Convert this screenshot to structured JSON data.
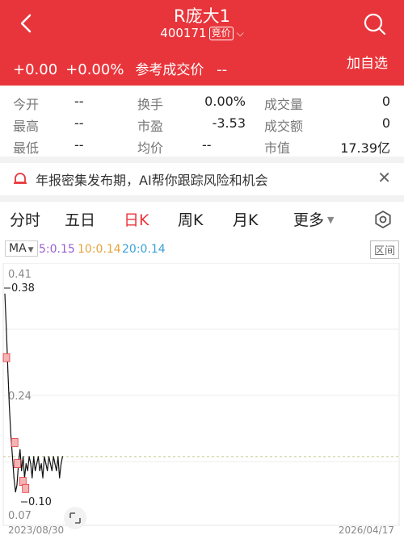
{
  "header": {
    "title": "R庞大1",
    "code": "400171",
    "badge": "竞价",
    "change": "+0.00",
    "change_pct": "+0.00%",
    "ref_label": "参考成交价",
    "ref_value": "--",
    "add_fav": "加自选",
    "bg_color": "#e8353b"
  },
  "stats": [
    {
      "label": "今开",
      "value": "--"
    },
    {
      "label": "换手",
      "value": "0.00%"
    },
    {
      "label": "成交量",
      "value": "0"
    },
    {
      "label": "最高",
      "value": "--"
    },
    {
      "label": "市盈",
      "value": "-3.53"
    },
    {
      "label": "成交额",
      "value": "0"
    },
    {
      "label": "最低",
      "value": "--"
    },
    {
      "label": "均价",
      "value": "--"
    },
    {
      "label": "市值",
      "value": "17.39亿"
    }
  ],
  "notice": {
    "text": "年报密集发布期，AI帮你跟踪风险和机会",
    "close": "✕"
  },
  "tabs": [
    {
      "label": "分时",
      "active": false
    },
    {
      "label": "五日",
      "active": false
    },
    {
      "label": "日K",
      "active": true
    },
    {
      "label": "周K",
      "active": false
    },
    {
      "label": "月K",
      "active": false
    },
    {
      "label": "更多",
      "active": false
    }
  ],
  "ma": {
    "selector": "MA",
    "ma5": "5:0.15",
    "ma10": "10:0.14",
    "ma20": "20:0.14",
    "interval": "区间"
  },
  "chart_data": {
    "type": "line",
    "y_ticks": [
      "0.41",
      "0.24",
      "0.07"
    ],
    "ylim": [
      0.07,
      0.41
    ],
    "high_label": "0.38",
    "low_label": "0.10",
    "x_start": "2023/08/30",
    "x_end": "2026/04/17",
    "ref_price": 0.15,
    "series": [
      {
        "values": [
          0.38,
          0.33,
          0.27,
          0.22,
          0.18,
          0.15,
          0.12,
          0.1,
          0.11,
          0.14,
          0.16,
          0.13,
          0.15,
          0.12,
          0.14,
          0.13,
          0.15,
          0.14,
          0.12,
          0.15,
          0.13,
          0.14,
          0.15,
          0.13,
          0.14,
          0.12,
          0.15,
          0.14,
          0.13,
          0.15,
          0.14,
          0.13,
          0.15,
          0.14,
          0.13,
          0.15,
          0.12,
          0.14,
          0.15
        ]
      }
    ]
  }
}
